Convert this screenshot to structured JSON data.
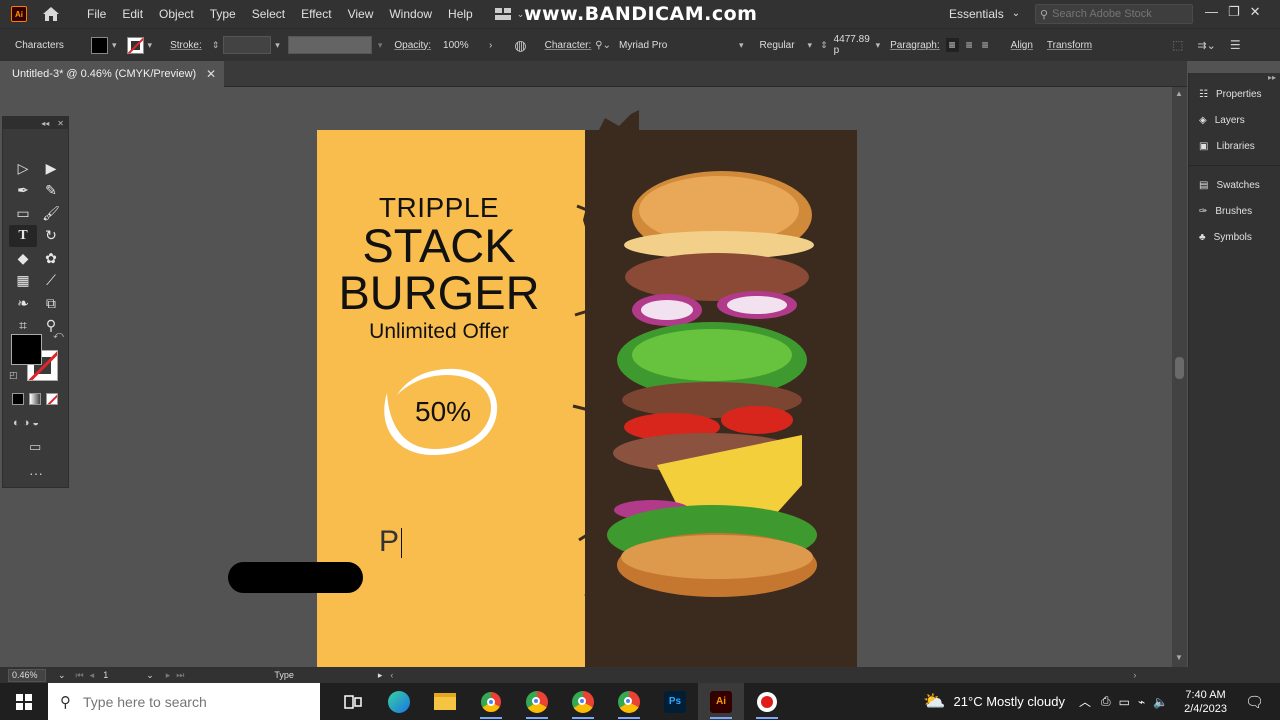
{
  "menubar": {
    "app_logo": "Ai",
    "items": [
      "File",
      "Edit",
      "Object",
      "Type",
      "Select",
      "Effect",
      "View",
      "Window",
      "Help"
    ],
    "watermark": "www.BANDICAM.com",
    "workspace": "Essentials",
    "stock_search_placeholder": "Search Adobe Stock"
  },
  "controlbar": {
    "panel_name": "Characters",
    "stroke_label": "Stroke:",
    "opacity_label": "Opacity:",
    "opacity_value": "100%",
    "character_label": "Character:",
    "font_family": "Myriad Pro",
    "font_style": "Regular",
    "font_size": "4477.89 p",
    "paragraph_label": "Paragraph:",
    "align_label": "Align",
    "transform_label": "Transform"
  },
  "document": {
    "tab_title": "Untitled-3* @ 0.46% (CMYK/Preview)"
  },
  "artboard": {
    "line1": "TRIPPLE",
    "line2": "STACK",
    "line3": "BURGER",
    "line4": "Unlimited Offer",
    "discount": "50%",
    "typing_text": "P",
    "colors": {
      "yellow": "#f8bd4d",
      "dark_brown": "#3b2b1e"
    }
  },
  "right_panel": {
    "group1": [
      "Properties",
      "Layers",
      "Libraries"
    ],
    "group2": [
      "Swatches",
      "Brushes",
      "Symbols"
    ]
  },
  "statusbar": {
    "zoom": "0.46%",
    "artboard_num": "1",
    "current_tool": "Type"
  },
  "taskbar": {
    "search_placeholder": "Type here to search",
    "weather": "21°C  Mostly cloudy",
    "time": "7:40 AM",
    "date": "2/4/2023"
  }
}
